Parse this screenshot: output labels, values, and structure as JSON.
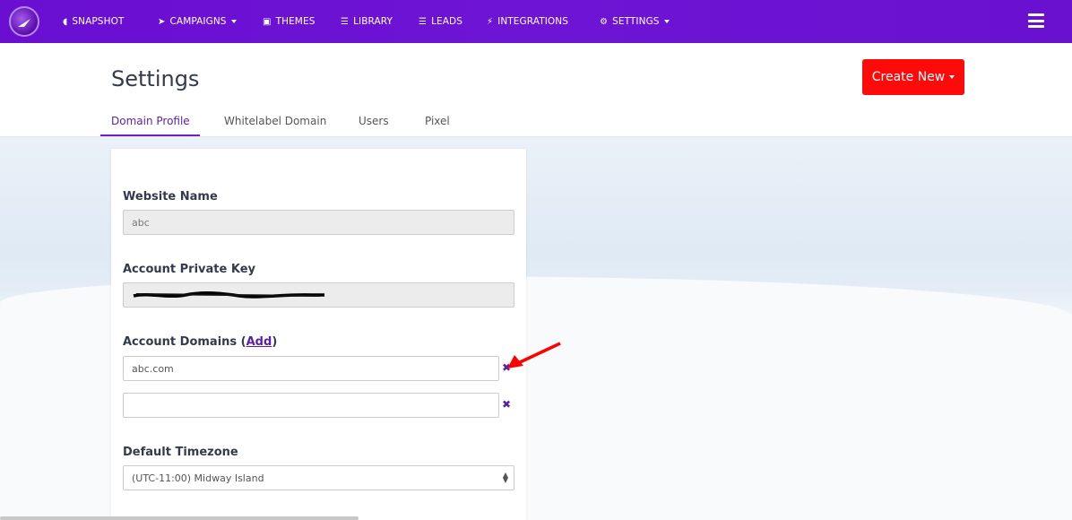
{
  "nav": {
    "items": [
      {
        "label": "SNAPSHOT",
        "icon": "dashboard-icon"
      },
      {
        "label": "CAMPAIGNS",
        "icon": "paper-plane-icon",
        "has_caret": true
      },
      {
        "label": "THEMES",
        "icon": "image-icon"
      },
      {
        "label": "LIBRARY",
        "icon": "library-icon"
      },
      {
        "label": "LEADS",
        "icon": "list-icon"
      },
      {
        "label": "INTEGRATIONS",
        "icon": "plug-icon"
      },
      {
        "label": "SETTINGS",
        "icon": "cogs-icon",
        "has_caret": true
      }
    ],
    "colors": {
      "bar": "#6a10cf"
    }
  },
  "page": {
    "title": "Settings",
    "create_button": "Create New",
    "create_button_color": "#ff0a0a",
    "tabs": [
      {
        "label": "Domain Profile",
        "active": true
      },
      {
        "label": "Whitelabel Domain"
      },
      {
        "label": "Users"
      },
      {
        "label": "Pixel"
      }
    ]
  },
  "form": {
    "website_name_label": "Website Name",
    "website_name_value": "abc",
    "private_key_label": "Account Private Key",
    "private_key_value": "redacted",
    "domains_label": "Account Domains (",
    "domains_add_link": "Add",
    "domains_label_end": ")",
    "domains": [
      "abc.com",
      ""
    ],
    "remove_icon": "close-icon",
    "timezone_label": "Default Timezone",
    "timezone_value": "(UTC-11:00) Midway Island"
  },
  "annotation": {
    "icon": "red-arrow-icon",
    "color": "#ff0000"
  }
}
